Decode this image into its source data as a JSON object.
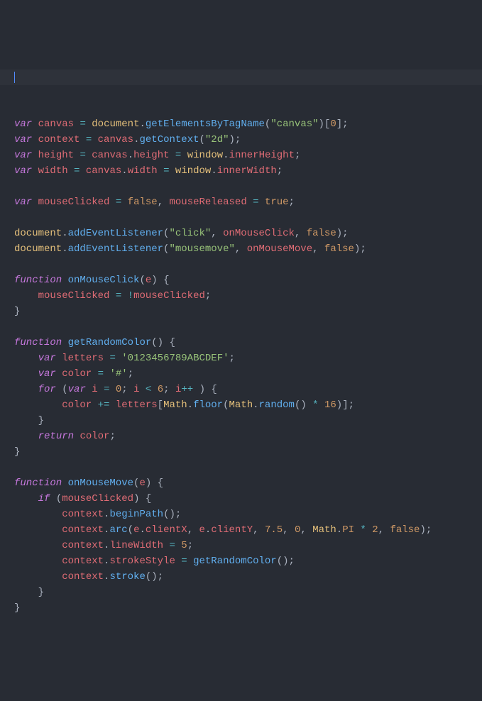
{
  "code": {
    "line1": {
      "kw_var": "var",
      "sp": " ",
      "id_canvas": "canvas",
      "eq": " = ",
      "obj_doc": "document",
      "dot1": ".",
      "fn_get": "getElementsByTagName",
      "p_open": "(",
      "str_canvas": "\"canvas\"",
      "p_close": ")",
      "br_open": "[",
      "num_0": "0",
      "br_close": "]",
      "semi": ";"
    },
    "line2": {
      "kw_var": "var",
      "sp": " ",
      "id_ctx": "context",
      "eq": " = ",
      "id_canvas": "canvas",
      "dot": ".",
      "fn_get": "getContext",
      "p_open": "(",
      "str_2d": "\"2d\"",
      "p_close": ")",
      "semi": ";"
    },
    "line3": {
      "kw_var": "var",
      "sp": " ",
      "id_h": "height",
      "eq1": " = ",
      "id_canvas": "canvas",
      "dot1": ".",
      "prop_h": "height",
      "eq2": " = ",
      "obj_win": "window",
      "dot2": ".",
      "prop_ih": "innerHeight",
      "semi": ";"
    },
    "line4": {
      "kw_var": "var",
      "sp": " ",
      "id_w": "width",
      "eq1": " = ",
      "id_canvas": "canvas",
      "dot1": ".",
      "prop_w": "width",
      "eq2": " = ",
      "obj_win": "window",
      "dot2": ".",
      "prop_iw": "innerWidth",
      "semi": ";"
    },
    "line6": {
      "kw_var": "var",
      "sp": " ",
      "id_mc": "mouseClicked",
      "eq1": " = ",
      "c_false": "false",
      "comma": ", ",
      "id_mr": "mouseReleased",
      "eq2": " = ",
      "c_true": "true",
      "semi": ";"
    },
    "line8": {
      "obj_doc": "document",
      "dot": ".",
      "fn_ael": "addEventListener",
      "p_open": "(",
      "str_click": "\"click\"",
      "c1": ", ",
      "id_omc": "onMouseClick",
      "c2": ", ",
      "c_false": "false",
      "p_close": ")",
      "semi": ";"
    },
    "line9": {
      "obj_doc": "document",
      "dot": ".",
      "fn_ael": "addEventListener",
      "p_open": "(",
      "str_mm": "\"mousemove\"",
      "c1": ", ",
      "id_omm": "onMouseMove",
      "c2": ", ",
      "c_false": "false",
      "p_close": ")",
      "semi": ";"
    },
    "line11": {
      "kw_fn": "function",
      "sp": " ",
      "fn_name": "onMouseClick",
      "p_open": "(",
      "param_e": "e",
      "p_close": ") ",
      "brace": "{"
    },
    "line12": {
      "indent": "    ",
      "id_mc1": "mouseClicked",
      "eq": " = ",
      "bang": "!",
      "id_mc2": "mouseClicked",
      "semi": ";"
    },
    "line13": {
      "brace": "}"
    },
    "line15": {
      "kw_fn": "function",
      "sp": " ",
      "fn_name": "getRandomColor",
      "parens": "() ",
      "brace": "{"
    },
    "line16": {
      "indent": "    ",
      "kw_var": "var",
      "sp": " ",
      "id_let": "letters",
      "eq": " = ",
      "str_hex": "'0123456789ABCDEF'",
      "semi": ";"
    },
    "line17": {
      "indent": "    ",
      "kw_var": "var",
      "sp": " ",
      "id_col": "color",
      "eq": " = ",
      "str_hash": "'#'",
      "semi": ";"
    },
    "line18": {
      "indent": "    ",
      "kw_for": "for",
      "sp": " (",
      "kw_var": "var",
      "sp2": " ",
      "id_i": "i",
      "eq": " = ",
      "num_0": "0",
      "semi1": "; ",
      "id_i2": "i",
      "lt": " < ",
      "num_6": "6",
      "semi2": "; ",
      "id_i3": "i",
      "inc": "++",
      "sp3": " ) ",
      "brace": "{"
    },
    "line19": {
      "indent": "        ",
      "id_col": "color",
      "pluseq": " += ",
      "id_let": "letters",
      "br_open": "[",
      "obj_math": "Math",
      "dot1": ".",
      "fn_floor": "floor",
      "p_open": "(",
      "obj_math2": "Math",
      "dot2": ".",
      "fn_rand": "random",
      "parens": "() ",
      "mult": "* ",
      "num_16": "16",
      "p_close": ")",
      "br_close": "]",
      "semi": ";"
    },
    "line20": {
      "indent": "    ",
      "brace": "}"
    },
    "line21": {
      "indent": "    ",
      "kw_ret": "return",
      "sp": " ",
      "id_col": "color",
      "semi": ";"
    },
    "line22": {
      "brace": "}"
    },
    "line24": {
      "kw_fn": "function",
      "sp": " ",
      "fn_name": "onMouseMove",
      "p_open": "(",
      "param_e": "e",
      "p_close": ") ",
      "brace": "{"
    },
    "line25": {
      "indent": "    ",
      "kw_if": "if",
      "sp": " (",
      "id_mc": "mouseClicked",
      "p_close": ") ",
      "brace": "{"
    },
    "line26": {
      "indent": "        ",
      "id_ctx": "context",
      "dot": ".",
      "fn_bp": "beginPath",
      "parens": "()",
      "semi": ";"
    },
    "line27": {
      "indent": "        ",
      "id_ctx": "context",
      "dot": ".",
      "fn_arc": "arc",
      "p_open": "(",
      "id_e1": "e",
      "dot1": ".",
      "prop_cx": "clientX",
      "c1": ", ",
      "id_e2": "e",
      "dot2": ".",
      "prop_cy": "clientY",
      "c2": ", ",
      "num_75": "7.5",
      "c3": ", ",
      "num_0": "0",
      "c4": ", ",
      "obj_math": "Math",
      "dot3": ".",
      "prop_pi": "PI",
      "mul": " * ",
      "num_2": "2",
      "c5": ", ",
      "c_false": "false",
      "p_close": ")",
      "semi": ";"
    },
    "line28": {
      "indent": "        ",
      "id_ctx": "context",
      "dot": ".",
      "prop_lw": "lineWidth",
      "eq": " = ",
      "num_5": "5",
      "semi": ";"
    },
    "line29": {
      "indent": "        ",
      "id_ctx": "context",
      "dot": ".",
      "prop_ss": "strokeStyle",
      "eq": " = ",
      "fn_grc": "getRandomColor",
      "parens": "()",
      "semi": ";"
    },
    "line30": {
      "indent": "        ",
      "id_ctx": "context",
      "dot": ".",
      "fn_stroke": "stroke",
      "parens": "()",
      "semi": ";"
    },
    "line31": {
      "indent": "    ",
      "brace": "}"
    },
    "line32": {
      "brace": "}"
    }
  }
}
